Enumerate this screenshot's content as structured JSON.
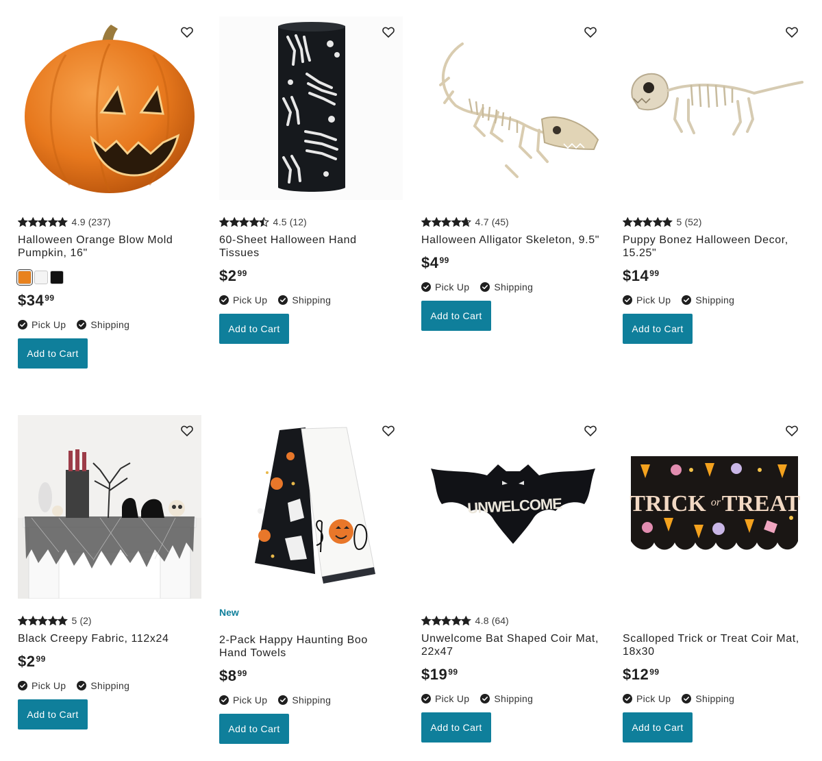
{
  "colors": {
    "accent": "#0f7f9b",
    "star": "#1f1f1f",
    "check": "#1f1f1f"
  },
  "products": [
    {
      "name": "Halloween Orange Blow Mold Pumpkin, 16\"",
      "rating_value": 4.9,
      "rating": "4.9",
      "reviews": "(237)",
      "price_dollars": "$34",
      "price_cents": "99",
      "swatches": [
        "#e8821e",
        "#f4f4f4",
        "#111111"
      ],
      "pickup": "Pick Up",
      "shipping": "Shipping",
      "cta": "Add to Cart",
      "image_icon": "pumpkin-image",
      "favorite_icon": "heart-icon"
    },
    {
      "name": "60-Sheet Halloween Hand Tissues",
      "rating_value": 4.5,
      "rating": "4.5",
      "reviews": "(12)",
      "price_dollars": "$2",
      "price_cents": "99",
      "pickup": "Pick Up",
      "shipping": "Shipping",
      "cta": "Add to Cart",
      "image_icon": "tissue-box-image",
      "favorite_icon": "heart-icon"
    },
    {
      "name": "Halloween Alligator Skeleton, 9.5\"",
      "rating_value": 4.7,
      "rating": "4.7",
      "reviews": "(45)",
      "price_dollars": "$4",
      "price_cents": "99",
      "pickup": "Pick Up",
      "shipping": "Shipping",
      "cta": "Add to Cart",
      "image_icon": "alligator-skeleton-image",
      "favorite_icon": "heart-icon"
    },
    {
      "name": "Puppy Bonez Halloween Decor, 15.25\"",
      "rating_value": 5,
      "rating": "5",
      "reviews": "(52)",
      "price_dollars": "$14",
      "price_cents": "99",
      "pickup": "Pick Up",
      "shipping": "Shipping",
      "cta": "Add to Cart",
      "image_icon": "dog-skeleton-image",
      "favorite_icon": "heart-icon"
    },
    {
      "name": "Black Creepy Fabric, 112x24",
      "rating_value": 5,
      "rating": "5",
      "reviews": "(2)",
      "price_dollars": "$2",
      "price_cents": "99",
      "pickup": "Pick Up",
      "shipping": "Shipping",
      "cta": "Add to Cart",
      "image_icon": "mantel-fabric-image",
      "favorite_icon": "heart-icon"
    },
    {
      "name": "2-Pack Happy Haunting Boo Hand Towels",
      "badge": "New",
      "price_dollars": "$8",
      "price_cents": "99",
      "pickup": "Pick Up",
      "shipping": "Shipping",
      "cta": "Add to Cart",
      "image_icon": "hand-towels-image",
      "favorite_icon": "heart-icon"
    },
    {
      "name": "Unwelcome Bat Shaped Coir Mat, 22x47",
      "rating_value": 4.8,
      "rating": "4.8",
      "reviews": "(64)",
      "price_dollars": "$19",
      "price_cents": "99",
      "mat_text": "UNWELCOME",
      "pickup": "Pick Up",
      "shipping": "Shipping",
      "cta": "Add to Cart",
      "image_icon": "bat-mat-image",
      "favorite_icon": "heart-icon"
    },
    {
      "name": "Scalloped Trick or Treat Coir Mat, 18x30",
      "price_dollars": "$12",
      "price_cents": "99",
      "mat_text_1": "TRICK",
      "mat_text_or": "or",
      "mat_text_2": "TREAT",
      "pickup": "Pick Up",
      "shipping": "Shipping",
      "cta": "Add to Cart",
      "image_icon": "trick-or-treat-mat-image",
      "favorite_icon": "heart-icon"
    }
  ]
}
